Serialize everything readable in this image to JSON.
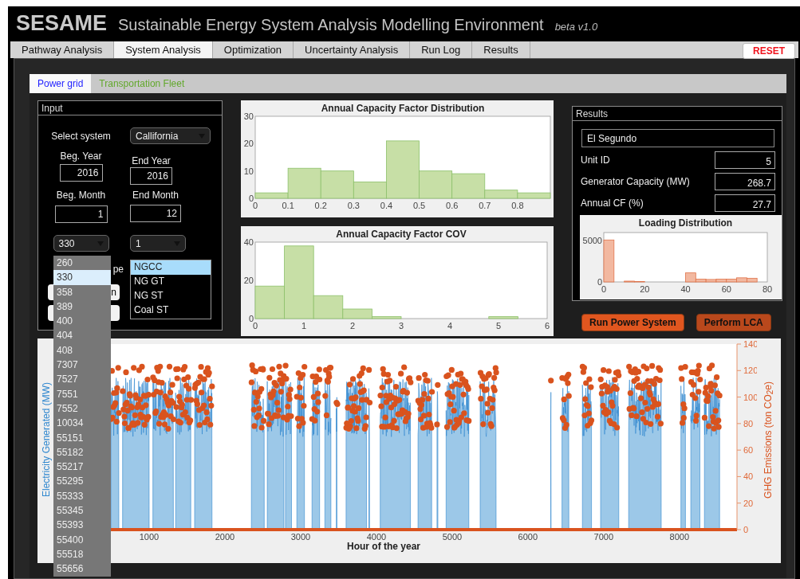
{
  "header": {
    "app_name": "SESAME",
    "subtitle": "Sustainable Energy System Analysis Modelling Environment",
    "version": "beta v1.0"
  },
  "tabs": [
    {
      "label": "Pathway Analysis",
      "selected": false
    },
    {
      "label": "System Analysis",
      "selected": true
    },
    {
      "label": "Optimization",
      "selected": false
    },
    {
      "label": "Uncertainty Analysis",
      "selected": false
    },
    {
      "label": "Run Log",
      "selected": false
    },
    {
      "label": "Results",
      "selected": false
    }
  ],
  "reset_button": "RESET",
  "subtabs": [
    {
      "label": "Power grid",
      "selected": true,
      "color": "#1f1fff"
    },
    {
      "label": "Transportation Fleet",
      "selected": false,
      "color": "#62a82c"
    }
  ],
  "input": {
    "title": "Input",
    "system_label": "Select system",
    "system_value": "Callifornia",
    "beg_year_label": "Beg. Year",
    "beg_year": "2016",
    "end_year_label": "End Year",
    "end_year": "2016",
    "beg_month_label": "Beg. Month",
    "beg_month": "1",
    "end_month_label": "End Month",
    "end_month": "12",
    "plant_value": "330",
    "unit_value": "1",
    "type_label_fragment": "pe",
    "generator_types": [
      {
        "label": "NGCC",
        "selected": true
      },
      {
        "label": "NG GT",
        "selected": false
      },
      {
        "label": "NG ST",
        "selected": false
      },
      {
        "label": "Coal ST",
        "selected": false
      }
    ],
    "covered_buttons": [
      {
        "kind": "button",
        "label": "n"
      },
      {
        "kind": "button"
      }
    ],
    "plant_options": [
      {
        "label": "260",
        "selected": false
      },
      {
        "label": "330",
        "selected": true
      },
      {
        "label": "358",
        "selected": false
      },
      {
        "label": "389",
        "selected": false
      },
      {
        "label": "400",
        "selected": false
      },
      {
        "label": "404",
        "selected": false
      },
      {
        "label": "408",
        "selected": false
      },
      {
        "label": "7307",
        "selected": false
      },
      {
        "label": "7527",
        "selected": false
      },
      {
        "label": "7551",
        "selected": false
      },
      {
        "label": "7552",
        "selected": false
      },
      {
        "label": "10034",
        "selected": false
      },
      {
        "label": "55151",
        "selected": false
      },
      {
        "label": "55182",
        "selected": false
      },
      {
        "label": "55217",
        "selected": false
      },
      {
        "label": "55295",
        "selected": false
      },
      {
        "label": "55333",
        "selected": false
      },
      {
        "label": "55345",
        "selected": false
      },
      {
        "label": "55393",
        "selected": false
      },
      {
        "label": "55400",
        "selected": false
      },
      {
        "label": "55518",
        "selected": false
      },
      {
        "label": "55656",
        "selected": false
      }
    ]
  },
  "charts": [
    {
      "chart_data": {
        "type": "bar",
        "title": "Annual Capacity Factor Distribution",
        "x": [
          0.05,
          0.15,
          0.25,
          0.35,
          0.45,
          0.55,
          0.65,
          0.75,
          0.85
        ],
        "values": [
          2,
          11,
          10,
          6,
          21,
          10,
          9,
          3,
          2
        ],
        "xlim": [
          0,
          0.9
        ],
        "ylim": [
          0,
          30
        ],
        "xticks": [
          0,
          0.1,
          0.2,
          0.3,
          0.4,
          0.5,
          0.6,
          0.7,
          0.8
        ],
        "yticks": [
          0,
          10,
          20,
          30
        ]
      }
    },
    {
      "chart_data": {
        "type": "bar",
        "title": "Annual Capacity Factor COV",
        "x": [
          0.3,
          0.9,
          1.5,
          2.1,
          2.7,
          5.1
        ],
        "values": [
          17,
          38,
          12,
          5,
          1,
          1
        ],
        "xlim": [
          0,
          6
        ],
        "ylim": [
          0,
          40
        ],
        "xticks": [
          0,
          1,
          2,
          3,
          4,
          5,
          6
        ],
        "yticks": [
          0,
          20,
          40
        ]
      }
    }
  ],
  "results": {
    "title": "Results",
    "plant_name": "El Segundo",
    "fields": [
      {
        "label": "Unit ID",
        "value": "5"
      },
      {
        "label": "Generator Capacity (MW)",
        "value": "268.7"
      },
      {
        "label": "Annual CF (%)",
        "value": "27.7"
      }
    ],
    "loading_chart": {
      "chart_data": {
        "type": "bar",
        "title": "Loading Distribution",
        "x": [
          2.5,
          12.5,
          17.5,
          42.5,
          47.5,
          52.5,
          57.5,
          62.5,
          67.5,
          72.5
        ],
        "values": [
          5100,
          100,
          50,
          1100,
          350,
          300,
          350,
          350,
          500,
          450
        ],
        "xlim": [
          0,
          80
        ],
        "ylim": [
          0,
          6000
        ],
        "xticks": [
          0,
          20,
          40,
          60,
          80
        ],
        "yticks": [
          0,
          5000
        ]
      }
    }
  },
  "actions": [
    {
      "label": "Run Power System",
      "color": "#e0561f"
    },
    {
      "label": "Perform LCA",
      "color": "#b9481c"
    }
  ],
  "hourly_plot": {
    "xlabel": "Hour of the year",
    "ylabel_left": "Electricity Generated (MW)",
    "ylabel_right": "GHG Emissions  (ton CO$_{2}$e)",
    "xticks": [
      "1000",
      "2000",
      "3000",
      "4000",
      "5000",
      "6000",
      "7000",
      "8000"
    ],
    "right_ticks": [
      "140",
      "120",
      "100",
      "80",
      "60",
      "40",
      "20",
      "0"
    ]
  }
}
